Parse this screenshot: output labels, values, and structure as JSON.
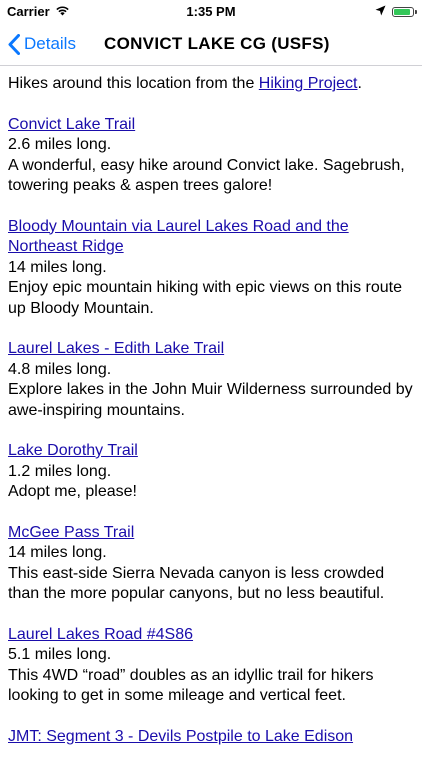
{
  "status_bar": {
    "carrier": "Carrier",
    "time": "1:35 PM",
    "battery_color": "#34c759"
  },
  "nav": {
    "back_label": "Details",
    "title": "CONVICT LAKE CG (USFS)",
    "accent_color": "#0a78ff"
  },
  "intro": {
    "prefix": "Hikes around this location from the ",
    "link": "Hiking Project",
    "suffix": "."
  },
  "hikes": [
    {
      "name": "Convict Lake Trail",
      "length": "2.6 miles long.",
      "description": "A wonderful, easy hike around Convict lake. Sagebrush, towering peaks & aspen trees galore!"
    },
    {
      "name": "Bloody Mountain via Laurel Lakes Road and the Northeast Ridge",
      "length": "14 miles long.",
      "description": "Enjoy epic mountain hiking with epic views on this route up Bloody Mountain."
    },
    {
      "name": "Laurel Lakes - Edith Lake Trail",
      "length": "4.8 miles long.",
      "description": "Explore lakes in the John Muir Wilderness surrounded by awe-inspiring mountains."
    },
    {
      "name": "Lake Dorothy Trail",
      "length": "1.2 miles long.",
      "description": "Adopt me, please!"
    },
    {
      "name": "McGee Pass Trail",
      "length": "14 miles long.",
      "description": "This east-side Sierra Nevada canyon is less crowded than the more popular canyons, but no less beautiful."
    },
    {
      "name": "Laurel Lakes Road #4S86",
      "length": "5.1 miles long.",
      "description": "This 4WD “road” doubles as an idyllic trail for hikers looking to get in some mileage and vertical feet."
    },
    {
      "name": "JMT: Segment 3 - Devils Postpile to Lake Edison",
      "length": "",
      "description": ""
    }
  ]
}
